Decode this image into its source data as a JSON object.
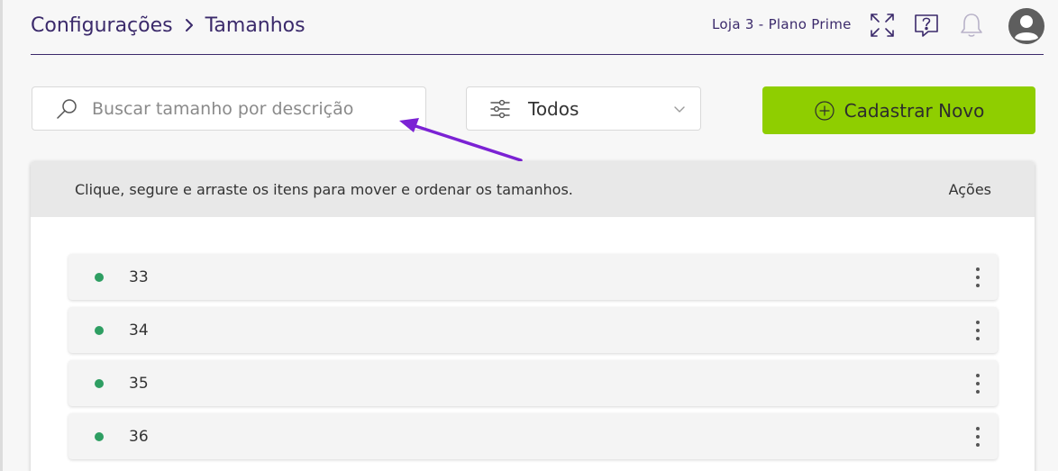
{
  "breadcrumb": {
    "parent": "Configurações",
    "current": "Tamanhos"
  },
  "header": {
    "store_name": "Loja 3 - Plano Prime"
  },
  "search": {
    "placeholder": "Buscar tamanho por descrição"
  },
  "filter": {
    "value": "Todos"
  },
  "new_button": {
    "label": "Cadastrar Novo"
  },
  "panel": {
    "instruction": "Clique, segure e arraste os itens para mover e ordenar os tamanhos.",
    "actions_label": "Ações"
  },
  "rows": [
    {
      "label": "33"
    },
    {
      "label": "34"
    },
    {
      "label": "35"
    },
    {
      "label": "36"
    }
  ],
  "colors": {
    "brand_purple": "#3b2a6b",
    "primary_green": "#8fce00",
    "status_green": "#2e9e62",
    "annotation_arrow": "#7b22d4"
  },
  "icons": {
    "breadcrumb_separator": "chevron-right-icon",
    "fullscreen": "fullscreen-icon",
    "help": "help-chat-icon",
    "notifications": "bell-icon",
    "user": "avatar-icon",
    "search": "search-icon",
    "filter": "filter-sliders-icon",
    "dropdown": "chevron-down-icon",
    "add": "plus-circle-icon",
    "row_menu": "kebab-menu-icon"
  }
}
